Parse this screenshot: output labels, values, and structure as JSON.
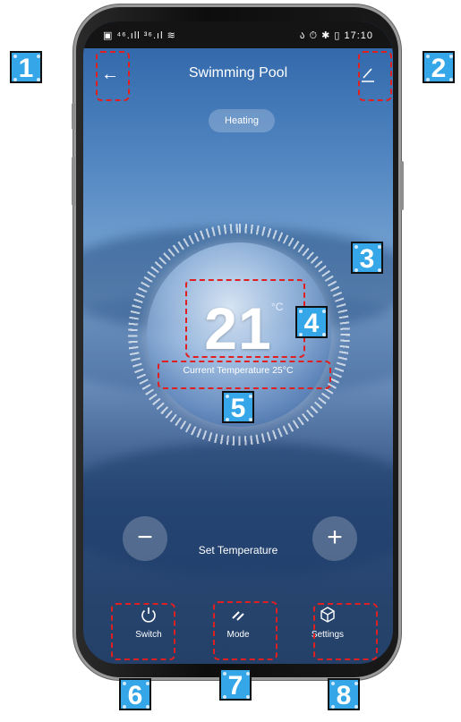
{
  "status_bar": {
    "left": "▣ ⁴⁶.ıll ³⁶.ıl ≋",
    "right": "ა ⏱ ✱ ▯ 17:10"
  },
  "header": {
    "back_glyph": "←",
    "title": "Swimming Pool",
    "edit_icon": "edit-icon"
  },
  "mode_pill": "Heating",
  "dial": {
    "set_temperature": "21",
    "unit": "°C",
    "current_label": "Current Temperature 25°C"
  },
  "controls": {
    "minus": "−",
    "plus": "+",
    "label": "Set Temperature"
  },
  "bottom_bar": {
    "items": [
      {
        "label": "Switch",
        "icon": "power-icon"
      },
      {
        "label": "Mode",
        "icon": "mode-icon"
      },
      {
        "label": "Settings",
        "icon": "cube-icon"
      }
    ]
  },
  "annotations": {
    "markers": [
      "1",
      "2",
      "3",
      "4",
      "5",
      "6",
      "7",
      "8"
    ]
  },
  "colors": {
    "annotation_dash": "#e02020",
    "marker_bg": "#35a7e8"
  }
}
